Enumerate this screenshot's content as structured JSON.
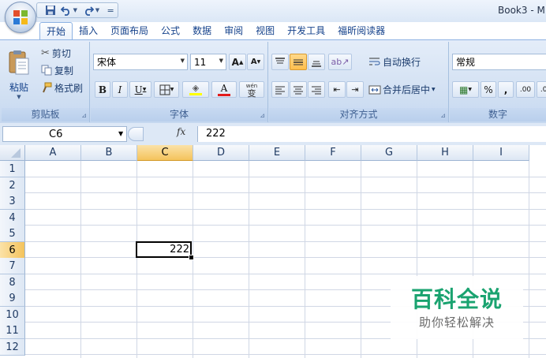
{
  "window": {
    "title": "Book3 - M"
  },
  "qat": {
    "save_icon": "save-icon",
    "undo_icon": "undo-icon",
    "redo_icon": "redo-icon",
    "customize_glyph": "="
  },
  "tabs": [
    {
      "label": "开始",
      "active": true
    },
    {
      "label": "插入"
    },
    {
      "label": "页面布局"
    },
    {
      "label": "公式"
    },
    {
      "label": "数据"
    },
    {
      "label": "审阅"
    },
    {
      "label": "视图"
    },
    {
      "label": "开发工具"
    },
    {
      "label": "福昕阅读器"
    }
  ],
  "clipboard": {
    "group_label": "剪贴板",
    "paste": "粘贴",
    "cut": "剪切",
    "copy": "复制",
    "format_painter": "格式刷"
  },
  "font": {
    "group_label": "字体",
    "family": "宋体",
    "size": "11",
    "bold": "B",
    "italic": "I",
    "underline": "U",
    "grow": "A",
    "shrink": "A",
    "phonetic": "wén",
    "phonetic_char": "变"
  },
  "alignment": {
    "group_label": "对齐方式",
    "wrap": "自动换行",
    "merge": "合并后居中"
  },
  "number": {
    "group_label": "数字",
    "format": "常规",
    "percent": "%",
    "comma": ",",
    "inc_decimal": ".00",
    "dec_decimal": ".00"
  },
  "formula_bar": {
    "name_box": "C6",
    "fx": "fx",
    "value": "222"
  },
  "grid": {
    "columns": [
      "A",
      "B",
      "C",
      "D",
      "E",
      "F",
      "G",
      "H",
      "I"
    ],
    "rows": [
      "1",
      "2",
      "3",
      "4",
      "5",
      "6",
      "7",
      "8",
      "9",
      "10",
      "11",
      "12"
    ],
    "selected_column": "C",
    "selected_row": "6",
    "active_cell": {
      "ref": "C6",
      "value": "222"
    }
  },
  "watermark": {
    "title": "百科全说",
    "subtitle": "助你轻松解决"
  }
}
